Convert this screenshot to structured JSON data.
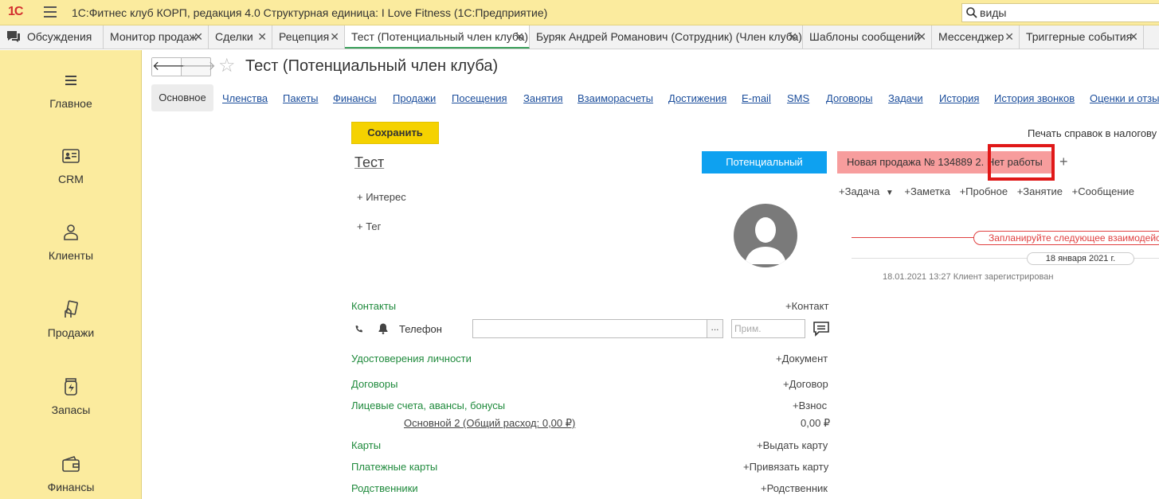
{
  "titlebar": {
    "logo": "1С",
    "title": "1С:Фитнес клуб КОРП, редакция 4.0 Структурная единица: I Love Fitness  (1С:Предприятие)",
    "search_value": "виды"
  },
  "tabs": [
    {
      "label": "Обсуждения"
    },
    {
      "label": "Монитор продаж"
    },
    {
      "label": "Сделки"
    },
    {
      "label": "Рецепция"
    },
    {
      "label": "Тест (Потенциальный член клуба)"
    },
    {
      "label": "Буряк Андрей Романович (Сотрудник) (Член клуба)"
    },
    {
      "label": "Шаблоны сообщений"
    },
    {
      "label": "Мессенджер"
    },
    {
      "label": "Триггерные события"
    }
  ],
  "sidebar": {
    "items": [
      {
        "label": "Главное",
        "icon": "menu-icon"
      },
      {
        "label": "CRM",
        "icon": "contact-card-icon"
      },
      {
        "label": "Клиенты",
        "icon": "person-icon"
      },
      {
        "label": "Продажи",
        "icon": "hand-card-icon"
      },
      {
        "label": "Запасы",
        "icon": "jar-icon"
      },
      {
        "label": "Финансы",
        "icon": "wallet-icon"
      }
    ]
  },
  "header": {
    "title": "Тест (Потенциальный член клуба)"
  },
  "sections": {
    "main": "Основное",
    "links": [
      "Членства",
      "Пакеты",
      "Финансы",
      "Продажи",
      "Посещения",
      "Занятия",
      "Взаиморасчеты",
      "Достижения",
      "E-mail",
      "SMS",
      "Договоры",
      "Задачи",
      "История",
      "История звонков",
      "Оценки и отзы"
    ]
  },
  "form": {
    "save_label": "Сохранить",
    "print_label": "Печать справок в налогову",
    "name": "Тест",
    "status_label": "Потенциальный",
    "sale_label": "Новая продажа № 134889  2. Нет работы",
    "add_plus": "+",
    "interest_link": "+ Интерес",
    "tag_link": "+ Тег",
    "contacts_label": "Контакты",
    "add_contact": "+Контакт",
    "phone_label": "Телефон",
    "phone_value": "",
    "phone_dots": "...",
    "note_placeholder": "Прим.",
    "id_docs_label": "Удостоверения личности",
    "add_document": "+Документ",
    "contracts_label": "Договоры",
    "add_contract": "+Договор",
    "accounts_label": "Лицевые счета, авансы, бонусы",
    "add_deposit": "+Взнос",
    "account_name": "Основной 2 (Общий расход: 0,00 ₽)",
    "account_value": "0,00 ₽",
    "cards_label": "Карты",
    "issue_card": "+Выдать карту",
    "payment_cards_label": "Платежные карты",
    "bind_card": "+Привязать карту",
    "relatives_label": "Родственники",
    "add_relative": "+Родственник"
  },
  "timeline": {
    "task": "+Задача",
    "note": "+Заметка",
    "trial": "+Пробное",
    "lesson": "+Занятие",
    "message": "+Сообщение",
    "plan_label": "Запланируйте следующее взаимодейств",
    "date_label": "18 января 2021 г.",
    "event": "18.01.2021 13:27 Клиент зарегистрирован"
  },
  "colors": {
    "accent_yellow": "#fbeb9e",
    "save_button": "#f5d200",
    "status_blue": "#0ea1f0",
    "sale_pink": "#f79d9d",
    "highlight_red": "#e01818",
    "link_green": "#1f8a3c",
    "link_blue": "#1b4d9b"
  }
}
